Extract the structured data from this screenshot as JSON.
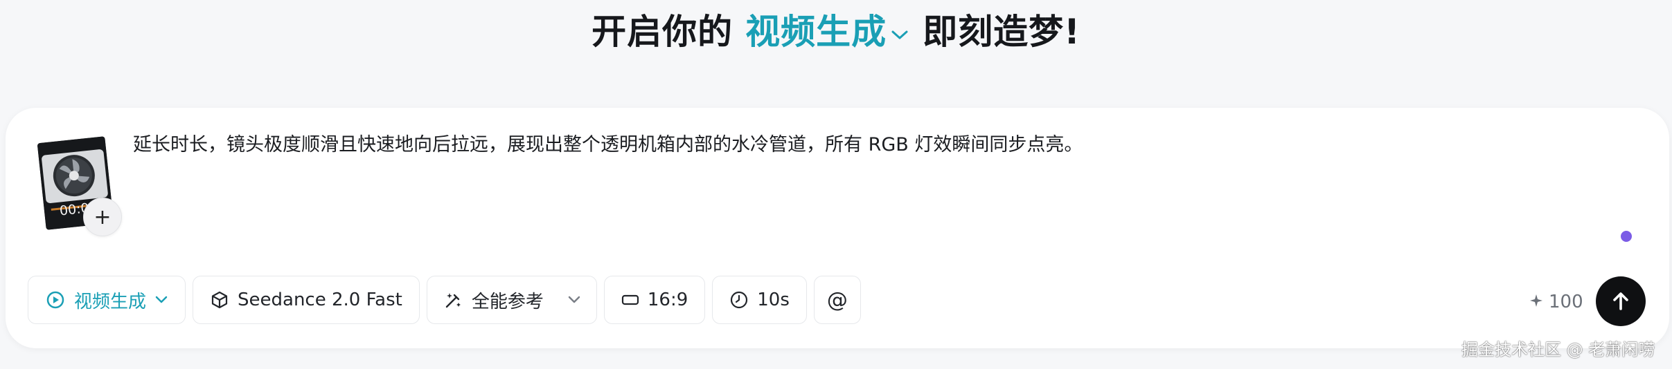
{
  "headline": {
    "prefix": "开启你的",
    "mode": "视频生成",
    "suffix": "即刻造梦!"
  },
  "composer": {
    "attachment": {
      "timecode": "00:0",
      "add_label": "+"
    },
    "prompt_text": "延长时长，镜头极度顺滑且快速地向后拉远，展现出整个透明机箱内部的水冷管道，所有 RGB 灯效瞬间同步点亮。"
  },
  "toolbar": {
    "mode_label": "视频生成",
    "model_label": "Seedance 2.0 Fast",
    "reference_label": "全能参考",
    "aspect_label": "16:9",
    "duration_label": "10s",
    "mention_label": "@"
  },
  "credits": {
    "icon": "sparkle-icon",
    "value": "100"
  },
  "watermark": "掘金技术社区 @ 老萧闲唠",
  "colors": {
    "accent": "#1a9fb5",
    "send_button": "#0f1012",
    "cursor_dot": "#7b5ce6"
  }
}
